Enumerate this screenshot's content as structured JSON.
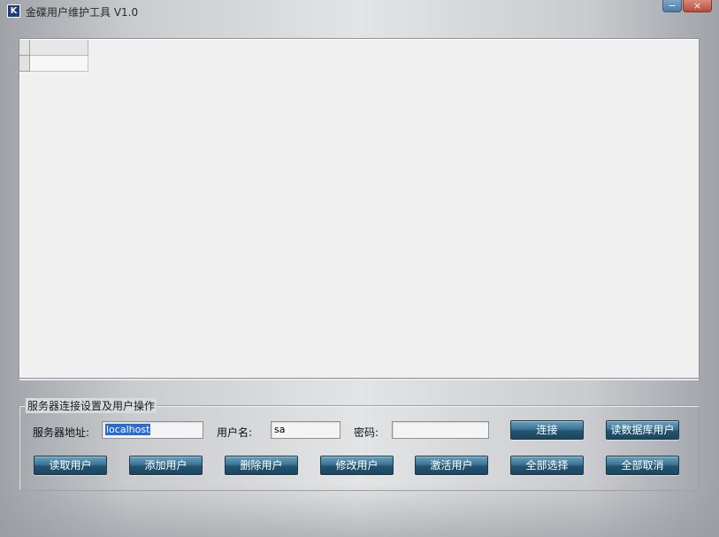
{
  "window": {
    "title": "金碟用户维护工具 V1.0",
    "app_icon_glyph": "K",
    "minimize_glyph": "−",
    "close_glyph": "×"
  },
  "group": {
    "legend": "服务器连接设置及用户操作"
  },
  "fields": {
    "server_label": "服务器地址:",
    "server_value": "localhost",
    "user_label": "用户名:",
    "user_value": "sa",
    "password_label": "密码:",
    "password_value": ""
  },
  "buttons": {
    "connect": "连接",
    "read_db_users": "读数据库用户",
    "read_users": "读取用户",
    "add_user": "添加用户",
    "delete_user": "删除用户",
    "edit_user": "修改用户",
    "activate_user": "激活用户",
    "select_all": "全部选择",
    "deselect_all": "全部取消"
  },
  "colors": {
    "button_accent": "#245470",
    "selection": "#2a6bd4"
  }
}
